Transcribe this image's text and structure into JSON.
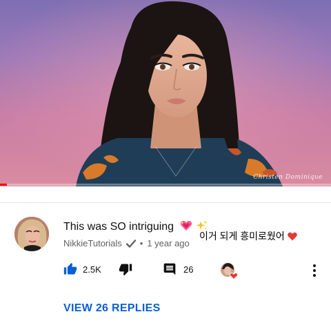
{
  "video": {
    "watermark": "Christen Dominique",
    "progress_fraction": 0.02,
    "colors": {
      "progress": "#ff0000"
    }
  },
  "comment": {
    "author": "NikkieTutorials",
    "text": "This was SO intriguing",
    "emoji": [
      "sparkling-heart-icon",
      "sparkles-icon"
    ],
    "translation": "이거 되게 흥미로웠어",
    "time": "1 year ago",
    "likes": "2.5K",
    "replies_count": "26",
    "view_replies": "VIEW 26 REPLIES",
    "colors": {
      "accent": "#065fd4",
      "heart": "#e0245e"
    }
  }
}
